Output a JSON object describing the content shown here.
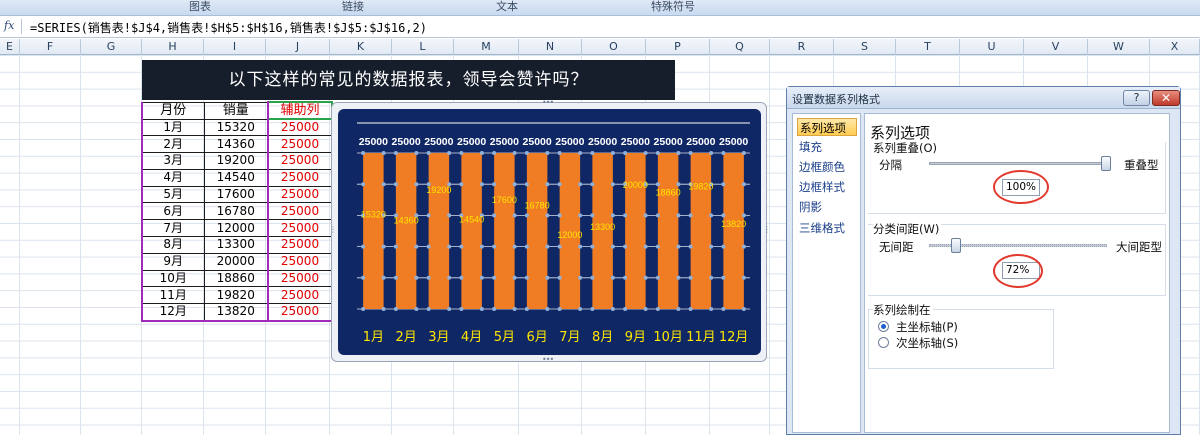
{
  "ribbon": {
    "groups": [
      "图表",
      "链接",
      "文本",
      "特殊符号"
    ]
  },
  "formula_bar": {
    "fx_label": "fx",
    "formula": "=SERIES(销售表!$J$4,销售表!$H$5:$H$16,销售表!$J$5:$J$16,2)"
  },
  "columns": [
    "E",
    "F",
    "G",
    "H",
    "I",
    "J",
    "K",
    "L",
    "M",
    "N",
    "O",
    "P",
    "Q",
    "R",
    "S",
    "T",
    "U",
    "V",
    "W",
    "X"
  ],
  "banner": {
    "title": "以下这样的常见的数据报表，领导会赞许吗？"
  },
  "sheet": {
    "headers": [
      "月份",
      "销量",
      "辅助列"
    ],
    "rows": [
      [
        "1月",
        "15320",
        "25000"
      ],
      [
        "2月",
        "14360",
        "25000"
      ],
      [
        "3月",
        "19200",
        "25000"
      ],
      [
        "4月",
        "14540",
        "25000"
      ],
      [
        "5月",
        "17600",
        "25000"
      ],
      [
        "6月",
        "16780",
        "25000"
      ],
      [
        "7月",
        "12000",
        "25000"
      ],
      [
        "8月",
        "13300",
        "25000"
      ],
      [
        "9月",
        "20000",
        "25000"
      ],
      [
        "10月",
        "18860",
        "25000"
      ],
      [
        "11月",
        "19820",
        "25000"
      ],
      [
        "12月",
        "13820",
        "25000"
      ]
    ]
  },
  "chart_data": {
    "type": "bar",
    "categories": [
      "1月",
      "2月",
      "3月",
      "4月",
      "5月",
      "6月",
      "7月",
      "8月",
      "9月",
      "10月",
      "11月",
      "12月"
    ],
    "series": [
      {
        "values": [
          15320,
          14360,
          19200,
          14540,
          17600,
          16780,
          12000,
          13300,
          20000,
          18860,
          19820,
          13820
        ]
      },
      {
        "values": [
          25000,
          25000,
          25000,
          25000,
          25000,
          25000,
          25000,
          25000,
          25000,
          25000,
          25000,
          25000
        ]
      }
    ],
    "overlap": "100%",
    "gap_width": "72%",
    "ylim": [
      0,
      25000
    ],
    "grid": true,
    "colors": {
      "background": "#102766",
      "bar": "#f07c24",
      "label_top": "#ffffff",
      "label_value": "#ffe600",
      "category": "#ffe600"
    }
  },
  "dialog": {
    "title": "设置数据系列格式",
    "help": "?",
    "close": "✕",
    "nav": [
      "系列选项",
      "填充",
      "边框颜色",
      "边框样式",
      "阴影",
      "三维格式"
    ],
    "section_title": "系列选项",
    "overlap": {
      "label": "系列重叠(O)",
      "left": "分隔",
      "right": "重叠型",
      "value": "100%",
      "level": 1.0
    },
    "gap": {
      "label": "分类间距(W)",
      "left": "无间距",
      "right": "大间距型",
      "value": "72%",
      "level": 0.144
    },
    "plot_on": {
      "label": "系列绘制在",
      "options": [
        "主坐标轴(P)",
        "次坐标轴(S)"
      ],
      "selected": 0
    }
  }
}
